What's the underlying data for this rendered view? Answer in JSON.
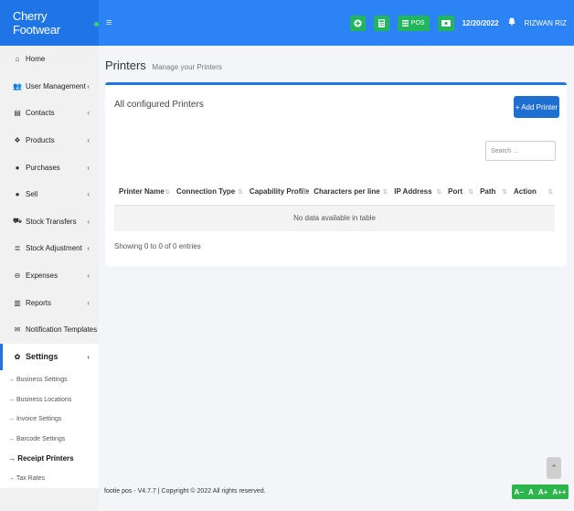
{
  "brand": {
    "name": "Cherry Footwear"
  },
  "header": {
    "menu_icon": "≡",
    "pos_label": "POS",
    "date": "12/20/2022",
    "user": "RIZWAN RIZ"
  },
  "sidebar": {
    "items": [
      {
        "label": "Home"
      },
      {
        "label": "User Management"
      },
      {
        "label": "Contacts"
      },
      {
        "label": "Products"
      },
      {
        "label": "Purchases"
      },
      {
        "label": "Sell"
      },
      {
        "label": "Stock Transfers"
      },
      {
        "label": "Stock Adjustment"
      },
      {
        "label": "Expenses"
      },
      {
        "label": "Reports"
      },
      {
        "label": "Notification Templates"
      },
      {
        "label": "Settings"
      }
    ],
    "sub_items": [
      {
        "label": "→ Business Settings"
      },
      {
        "label": "→ Business Locations"
      },
      {
        "label": "→ Invoice Settings"
      },
      {
        "label": "→ Barcode Settings"
      },
      {
        "label": "→ Receipt Printers"
      },
      {
        "label": "→ Tax Rates"
      }
    ]
  },
  "main": {
    "title": "Printers",
    "subtitle": "Manage your Printers",
    "box_title": "All configured Printers",
    "add_button": "+ Add Printer",
    "search_placeholder": "Search ...",
    "columns": [
      "Printer Name",
      "Connection Type",
      "Capability Profile",
      "Characters per line",
      "IP Address",
      "Port",
      "Path",
      "Action"
    ],
    "empty_text": "No data available in table",
    "showing_text": "Showing 0 to 0 of 0 entries"
  },
  "footer": {
    "text": "footie pos - V4.7.7 | Copyright © 2022 All rights reserved.",
    "font_controls": [
      "A−",
      "A",
      "A+",
      "A++"
    ]
  },
  "colors": {
    "brand_blue": "#1f75e5",
    "navbar_blue": "#2b83f6",
    "accent_green": "#21b55d"
  }
}
